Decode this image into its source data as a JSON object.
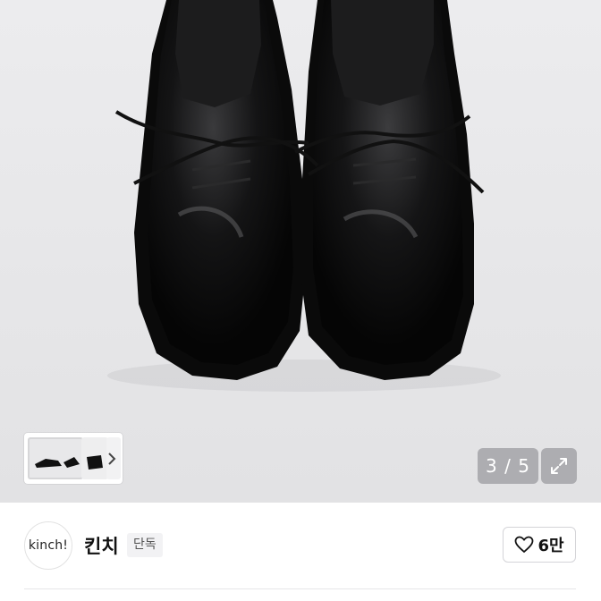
{
  "gallery": {
    "counter_current": "3",
    "counter_separator": "/",
    "counter_total": "5",
    "counter_text": "3 / 5",
    "thumbnail_next_icon": "chevron-right-icon",
    "fullscreen_icon": "expand-icon"
  },
  "seller": {
    "avatar_text": "kinch!",
    "name": "킨치",
    "badge": "단독"
  },
  "like": {
    "icon": "heart-outline-icon",
    "count": "6만"
  },
  "colors": {
    "image_background": "#e6e6e8",
    "overlay_button": "#8c8c90",
    "border": "#d4d4d8"
  }
}
